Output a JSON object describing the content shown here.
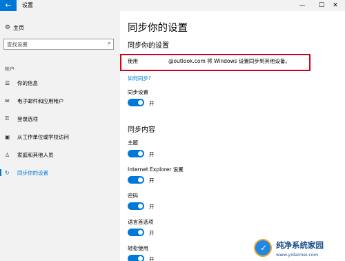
{
  "window": {
    "back_icon": "←",
    "title": "设置",
    "minimize": "—",
    "maximize": "☐",
    "close": "✕"
  },
  "sidebar": {
    "home": {
      "icon": "gear-icon",
      "label": "主页"
    },
    "search": {
      "placeholder": "查找设置",
      "icon": "search-icon"
    },
    "section": "帐户",
    "items": [
      {
        "label": "你的信息",
        "icon": "person-card-icon"
      },
      {
        "label": "电子邮件和应用帐户",
        "icon": "mail-icon"
      },
      {
        "label": "登录选项",
        "icon": "key-icon"
      },
      {
        "label": "从工作单位或学校访问",
        "icon": "briefcase-icon"
      },
      {
        "label": "家庭和其他人员",
        "icon": "person-icon"
      },
      {
        "label": "同步你的设置",
        "icon": "sync-icon",
        "active": true
      }
    ]
  },
  "main": {
    "title": "同步你的设置",
    "subtitle": "同步你的设置",
    "use_label": "使用",
    "sync_text": "@outlook.com 将 Windows 设置同步到其他设备。",
    "howto_link": "如何同步?",
    "sync_setting": {
      "label": "同步设置",
      "state": "开"
    },
    "content_title": "同步内容",
    "content_items": [
      {
        "label": "主题",
        "state": "开"
      },
      {
        "label": "Internet Explorer 设置",
        "state": "开"
      },
      {
        "label": "密码",
        "state": "开"
      },
      {
        "label": "语言首选项",
        "state": "开"
      },
      {
        "label": "轻松使用",
        "state": "开"
      }
    ]
  },
  "watermark": {
    "text": "纯净系统家园",
    "url": "www.yidaimei.com"
  },
  "colors": {
    "accent": "#0078d7",
    "highlight_box": "#d0021b",
    "sidebar_bg": "#f2f2f2"
  }
}
